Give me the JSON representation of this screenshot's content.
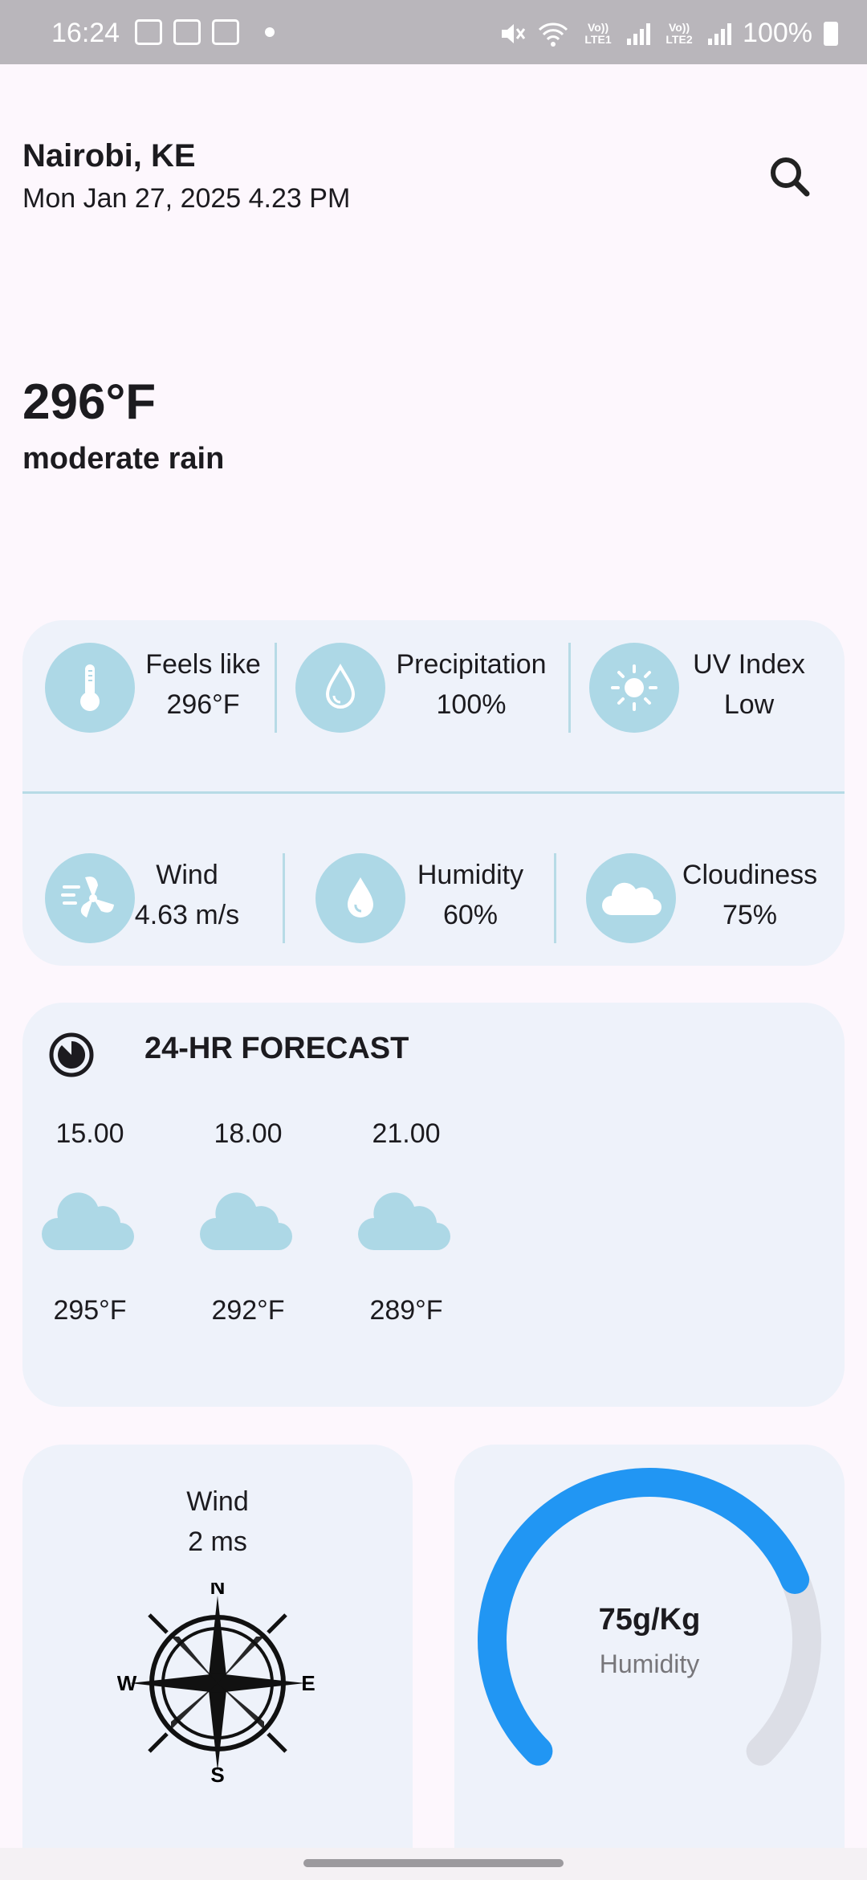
{
  "status_bar": {
    "time": "16:24",
    "sim1": "Vo)) LTE1",
    "sim2": "Vo)) LTE2",
    "battery": "100%"
  },
  "header": {
    "city": "Nairobi, KE",
    "date": "Mon Jan 27, 2025 4.23 PM",
    "search_icon": "search-icon"
  },
  "current": {
    "temperature": "296°F",
    "condition": "moderate rain"
  },
  "metrics": [
    {
      "label": "Feels like",
      "value": "296°F",
      "icon": "thermometer-icon"
    },
    {
      "label": "Precipitation",
      "value": "100%",
      "icon": "droplet-outline-icon"
    },
    {
      "label": "UV Index",
      "value": "Low",
      "icon": "sun-icon"
    },
    {
      "label": "Wind",
      "value": "4.63 m/s",
      "icon": "wind-fan-icon"
    },
    {
      "label": "Humidity",
      "value": "60%",
      "icon": "droplet-icon"
    },
    {
      "label": "Cloudiness",
      "value": "75%",
      "icon": "cloud-icon"
    }
  ],
  "forecast": {
    "title": "24-HR FORECAST",
    "items": [
      {
        "time": "15.00",
        "temp": "295°F",
        "icon": "cloud-icon"
      },
      {
        "time": "18.00",
        "temp": "292°F",
        "icon": "cloud-icon"
      },
      {
        "time": "21.00",
        "temp": "289°F",
        "icon": "cloud-icon"
      }
    ]
  },
  "wind_card": {
    "label": "Wind",
    "value": "2 ms",
    "compass": {
      "n": "N",
      "s": "S",
      "e": "E",
      "w": "W"
    }
  },
  "humidity_card": {
    "value": "75g/Kg",
    "label": "Humidity",
    "fraction": 0.75,
    "colors": {
      "fill": "#2196f3",
      "track": "#dcdee6"
    }
  }
}
